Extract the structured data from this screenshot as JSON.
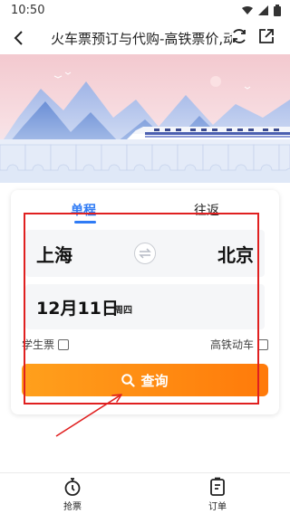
{
  "status_bar": {
    "time": "10:50"
  },
  "header": {
    "title": "火车票预订与代购-高铁票价,动..."
  },
  "tabs": {
    "one_way": "单程",
    "round_trip": "往返"
  },
  "route": {
    "from": "上海",
    "to": "北京"
  },
  "date": {
    "value": "12月11日",
    "weekday": "周四"
  },
  "options": {
    "student_ticket": "学生票",
    "high_speed": "高铁动车"
  },
  "search": {
    "label": "查询"
  },
  "bottom_nav": {
    "grab_tickets": "抢票",
    "orders": "订单"
  },
  "colors": {
    "accent_blue": "#2f7bf5",
    "search_orange": "#ff8a14",
    "annotation_red": "#e02020"
  }
}
